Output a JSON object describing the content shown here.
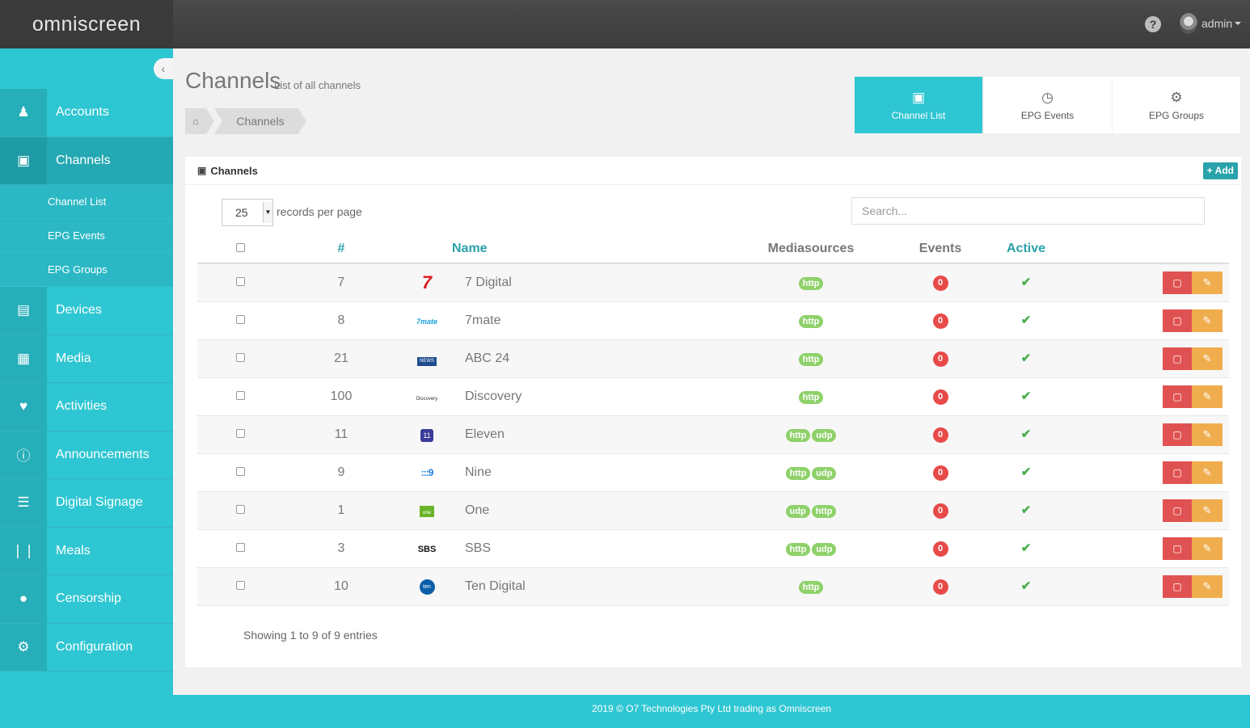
{
  "brand": {
    "logo": "omniscreen"
  },
  "topbar": {
    "help": "?",
    "user": "admin"
  },
  "sidebar": {
    "items": [
      {
        "label": "Accounts",
        "icon": "user-icon"
      },
      {
        "label": "Channels",
        "icon": "video-camera-icon"
      },
      {
        "label": "Devices",
        "icon": "hdd-icon"
      },
      {
        "label": "Media",
        "icon": "film-icon"
      },
      {
        "label": "Activities",
        "icon": "heart-icon"
      },
      {
        "label": "Announcements",
        "icon": "info-icon"
      },
      {
        "label": "Digital Signage",
        "icon": "list-icon"
      },
      {
        "label": "Meals",
        "icon": "cutlery-icon"
      },
      {
        "label": "Censorship",
        "icon": "lock-icon"
      },
      {
        "label": "Configuration",
        "icon": "cogs-icon"
      }
    ],
    "subitems": [
      "Channel List",
      "EPG Events",
      "EPG Groups"
    ]
  },
  "page": {
    "title": "Channels",
    "subtitle": "List of all channels"
  },
  "breadcrumb": {
    "current": "Channels"
  },
  "tabs": [
    {
      "label": "Channel List",
      "icon": "video-camera-icon"
    },
    {
      "label": "EPG Events",
      "icon": "clock-icon"
    },
    {
      "label": "EPG Groups",
      "icon": "gear-icon"
    }
  ],
  "panel": {
    "title": "Channels",
    "add_label": "+ Add"
  },
  "length": {
    "value": "25",
    "label": "records per page"
  },
  "search": {
    "placeholder": "Search..."
  },
  "columns": {
    "num": "#",
    "name": "Name",
    "mediasources": "Mediasources",
    "events": "Events",
    "active": "Active"
  },
  "rows": [
    {
      "num": "7",
      "logo": "7",
      "name": "7 Digital",
      "media": [
        "http"
      ],
      "events": "0"
    },
    {
      "num": "8",
      "logo": "7mate",
      "name": "7mate",
      "media": [
        "http"
      ],
      "events": "0"
    },
    {
      "num": "21",
      "logo": "NEWS",
      "name": "ABC 24",
      "media": [
        "http"
      ],
      "events": "0"
    },
    {
      "num": "100",
      "logo": "Discovery",
      "name": "Discovery",
      "media": [
        "http"
      ],
      "events": "0"
    },
    {
      "num": "11",
      "logo": "11",
      "name": "Eleven",
      "media": [
        "http",
        "udp"
      ],
      "events": "0"
    },
    {
      "num": "9",
      "logo": ":::9",
      "name": "Nine",
      "media": [
        "http",
        "udp"
      ],
      "events": "0"
    },
    {
      "num": "1",
      "logo": "one",
      "name": "One",
      "media": [
        "udp",
        "http"
      ],
      "events": "0"
    },
    {
      "num": "3",
      "logo": "SBS",
      "name": "SBS",
      "media": [
        "http",
        "udp"
      ],
      "events": "0"
    },
    {
      "num": "10",
      "logo": "ten",
      "name": "Ten Digital",
      "media": [
        "http"
      ],
      "events": "0"
    }
  ],
  "info": "Showing 1 to 9 of 9 entries",
  "footer": "2019 © O7 Technologies Pty Ltd trading as Omniscreen"
}
